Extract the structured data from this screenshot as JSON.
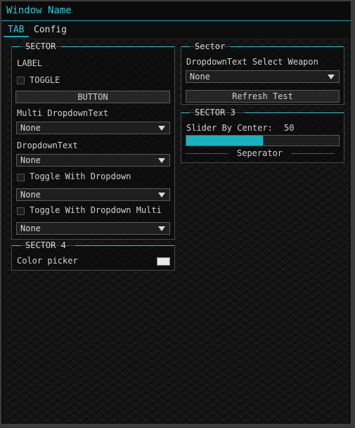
{
  "window": {
    "title": "Window Name"
  },
  "tabs": [
    {
      "label": "TAB"
    },
    {
      "label": "Config"
    }
  ],
  "sector1": {
    "title": "SECTOR",
    "label": "LABEL",
    "toggle_label": "TOGGLE",
    "button_label": "BUTTON",
    "multi_dropdown_label": "Multi DropdownText",
    "multi_dropdown_value": "None",
    "dropdown_label": "DropdownText",
    "dropdown_value": "None",
    "toggle_dropdown_label": "Toggle With Dropdown",
    "toggle_dropdown_value": "None",
    "toggle_dropdown_multi_label": "Toggle With Dropdown Multi",
    "toggle_dropdown_multi_value": "None"
  },
  "sector4": {
    "title": "SECTOR 4",
    "color_picker_label": "Color picker",
    "color_value": "#e8e8e8"
  },
  "sector2": {
    "title": "Sector",
    "dropdown_label": "DropdownText Select Weapon",
    "dropdown_value": "None",
    "button_label": "Refresh Test"
  },
  "sector3": {
    "title": "SECTOR 3",
    "slider_label": "Slider By Center:",
    "slider_value": "50",
    "slider_fraction": 0.5,
    "separator_label": "Seperator"
  },
  "colors": {
    "accent": "#2fc7d6",
    "slider_fill": "#17b3c2"
  }
}
